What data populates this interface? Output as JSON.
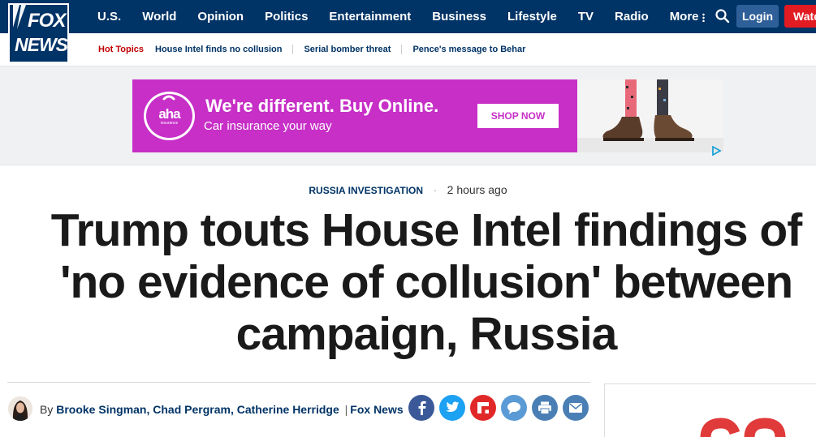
{
  "nav": {
    "logo_top": "FOX",
    "logo_bottom": "NEWS",
    "items": [
      "U.S.",
      "World",
      "Opinion",
      "Politics",
      "Entertainment",
      "Business",
      "Lifestyle",
      "TV",
      "Radio"
    ],
    "more_label": "More",
    "login_label": "Login",
    "watch_label": "Watch"
  },
  "hot_topics": {
    "label": "Hot Topics",
    "links": [
      "House Intel finds no collusion",
      "Serial bomber threat",
      "Pence's message to Behar"
    ]
  },
  "ad": {
    "logo_text": "aha",
    "logo_subtext": "insurance",
    "headline": "We're different. Buy Online.",
    "subline": "Car insurance your way",
    "cta": "SHOP NOW",
    "bg_color": "#c72fc7"
  },
  "article": {
    "category": "RUSSIA INVESTIGATION",
    "separator": "·",
    "timestamp": "2 hours ago",
    "headline_lines": [
      "Trump touts House Intel findings of",
      "'no evidence of collusion' between",
      "campaign, Russia"
    ],
    "byline_prefix": "By",
    "authors": "Brooke Singman, Chad Pergram, Catherine Herridge",
    "byline_pipe": "|",
    "source": "Fox News"
  },
  "share": [
    {
      "name": "facebook-icon",
      "color": "#3b5998"
    },
    {
      "name": "twitter-icon",
      "color": "#1da1f2"
    },
    {
      "name": "flipboard-icon",
      "color": "#e12828"
    },
    {
      "name": "comment-icon",
      "color": "#5b9bd5"
    },
    {
      "name": "print-icon",
      "color": "#4a7fb5"
    },
    {
      "name": "email-icon",
      "color": "#4a7fb5"
    }
  ],
  "colors": {
    "nav_bg": "#003366",
    "login_bg": "#2f5f98",
    "watch_bg": "#e11b22",
    "hot_topics": "#c00000",
    "link": "#003366"
  }
}
